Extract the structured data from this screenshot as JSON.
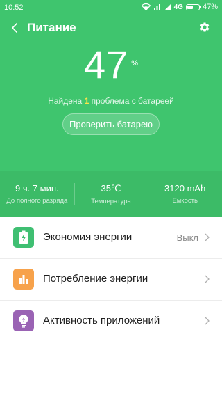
{
  "status_bar": {
    "time": "10:52",
    "network": "4G",
    "battery_percent": "47%",
    "battery_level": 0.47
  },
  "header": {
    "title": "Питание"
  },
  "battery": {
    "percent_value": "47",
    "percent_sign": "%",
    "problem_prefix": "Найдена",
    "problem_count": "1",
    "problem_suffix": "проблема с батареей",
    "check_button_label": "Проверить батарею"
  },
  "stats": [
    {
      "value": "9 ч. 7 мин.",
      "label": "До полного разряда"
    },
    {
      "value": "35℃",
      "label": "Температура"
    },
    {
      "value": "3120 mAh",
      "label": "Емкость"
    }
  ],
  "list": [
    {
      "label": "Экономия энергии",
      "value": "Выкл",
      "icon": "battery-saver-icon",
      "color": "#3fbf72"
    },
    {
      "label": "Потребление энергии",
      "value": "",
      "icon": "bar-chart-icon",
      "color": "#f7a24b"
    },
    {
      "label": "Активность приложений",
      "value": "",
      "icon": "lightbulb-icon",
      "color": "#9a63b4"
    }
  ],
  "colors": {
    "hero_green": "#3fc56e",
    "stats_green": "#3cbb67",
    "highlight_yellow": "#ffe54a"
  }
}
